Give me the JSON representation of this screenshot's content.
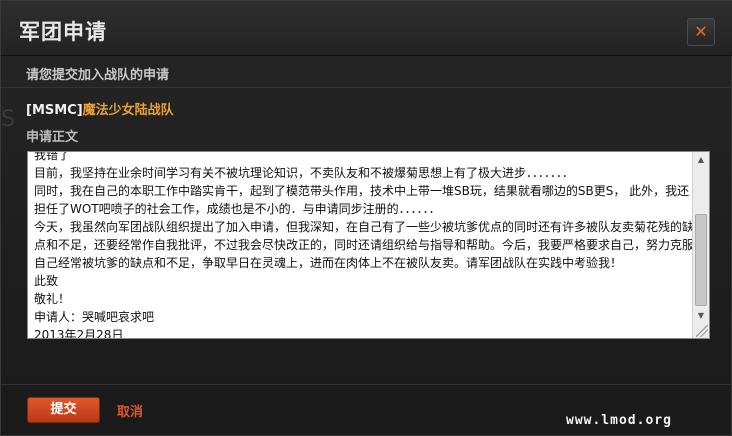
{
  "dialog": {
    "title": "军团申请",
    "close_glyph": "✕",
    "subtitle": "请您提交加入战队的申请",
    "team_tag": "[MSMC]",
    "team_name": "魔法少女陆战队",
    "section_label": "申请正文",
    "body_text": "我错了\n目前，我坚持在业余时间学习有关不被坑理论知识，不卖队友和不被爆菊思想上有了极大进步．．．．．．．\n同时，我在自己的本职工作中踏实肯干，起到了模范带头作用，技术中上带一堆SB玩，结果就看哪边的SB更S， 此外，我还担任了WOT吧喷子的社会工作，成绩也是不小的．与申请同步注册的．．．．．．\n今天，我虽然向军团战队组织提出了加入申请，但我深知，在自己有了一些少被坑爹优点的同时还有许多被队友卖菊花残的缺点和不足，还要经常作自我批评，不过我会尽快改正的，同时还请组织给与指导和帮助。今后，我要严格要求自己，努力克服自己经常被坑爹的缺点和不足，争取早日在灵魂上，进而在肉体上不在被队友卖。请军团战队在实践中考验我！\n此致\n敬礼！\n申请人：哭喊吧哀求吧\n2013年2月28日",
    "submit_label": "提交",
    "cancel_label": "取消",
    "bg_fragment": "S"
  },
  "watermark": "www.lmod.org",
  "colors": {
    "accent": "#e0562a",
    "team_name": "#e8a13a",
    "background": "#1e1e1e"
  }
}
